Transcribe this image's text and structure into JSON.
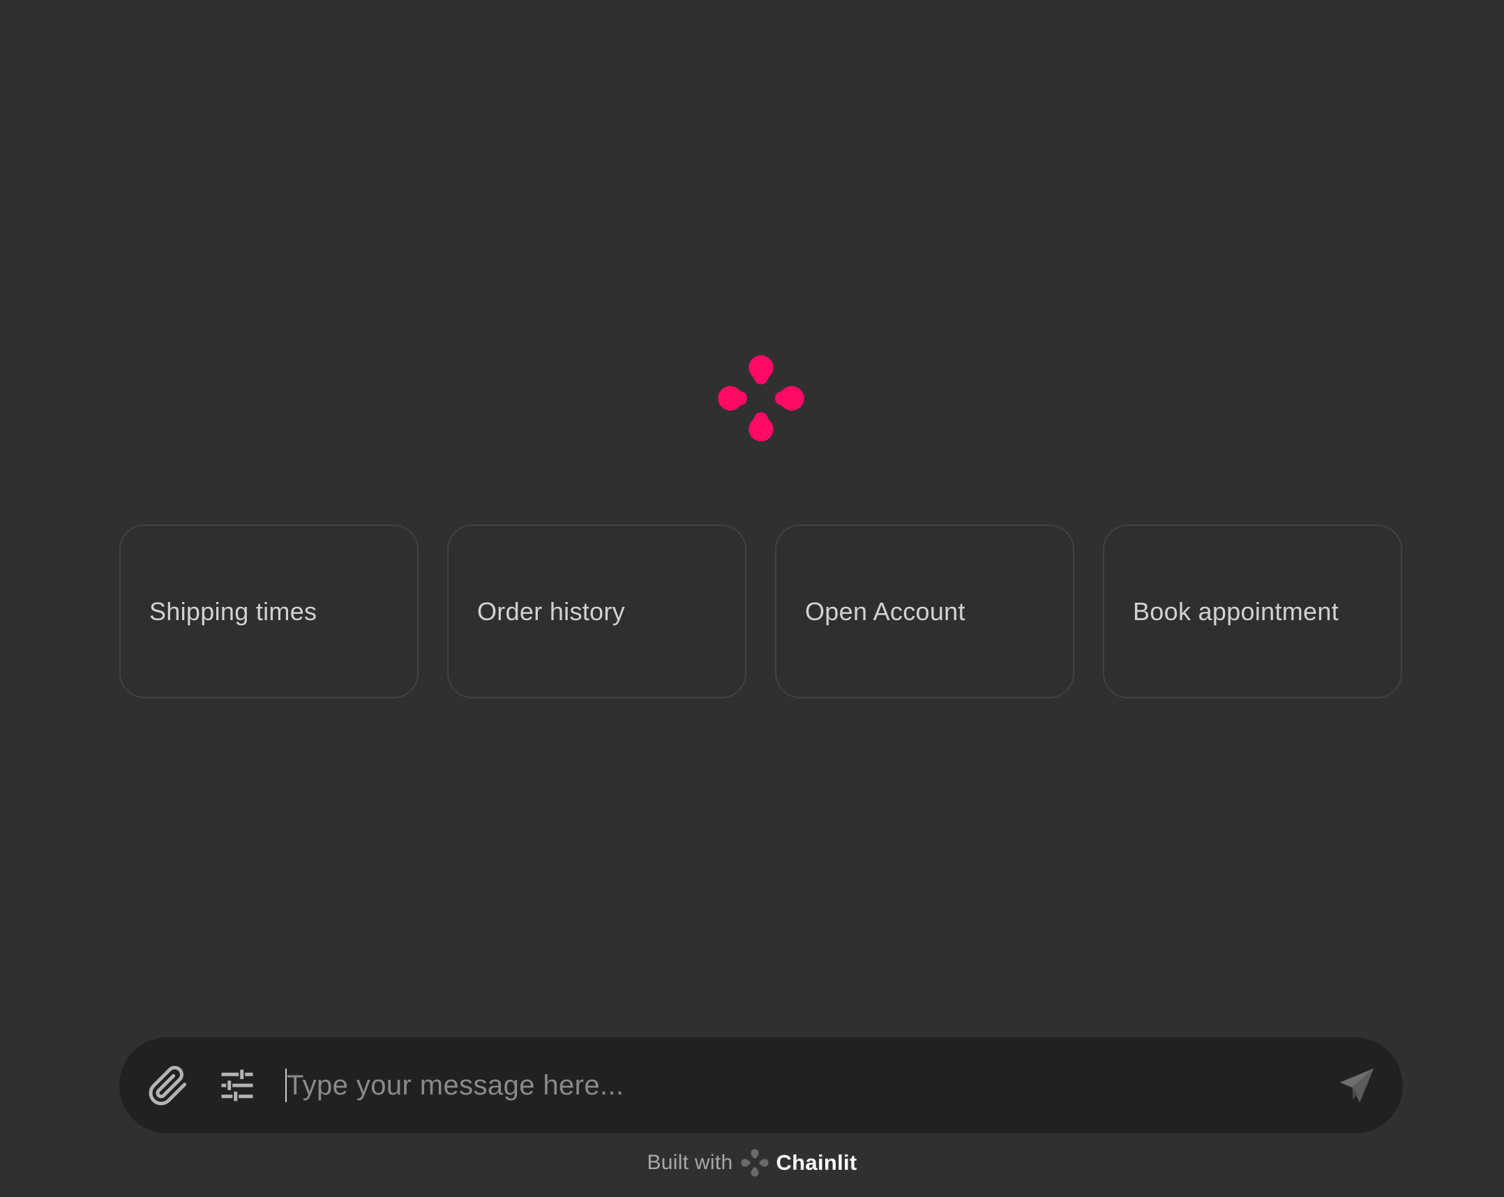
{
  "logo": {
    "icon": "chainlit-logo-icon",
    "color": "#FF0A64"
  },
  "starters": [
    {
      "label": "Shipping times"
    },
    {
      "label": "Order history"
    },
    {
      "label": "Open Account"
    },
    {
      "label": "Book appointment"
    }
  ],
  "composer": {
    "attach_icon": "paperclip-icon",
    "settings_icon": "sliders-icon",
    "send_icon": "send-icon",
    "input_value": "",
    "placeholder": "Type your message here..."
  },
  "footer": {
    "built_with": "Built with",
    "brand": "Chainlit",
    "brand_icon": "chainlit-logo-icon"
  },
  "colors": {
    "background": "#303030",
    "composer_bg": "#212121",
    "accent": "#FF0A64",
    "card_border": "#424242"
  }
}
